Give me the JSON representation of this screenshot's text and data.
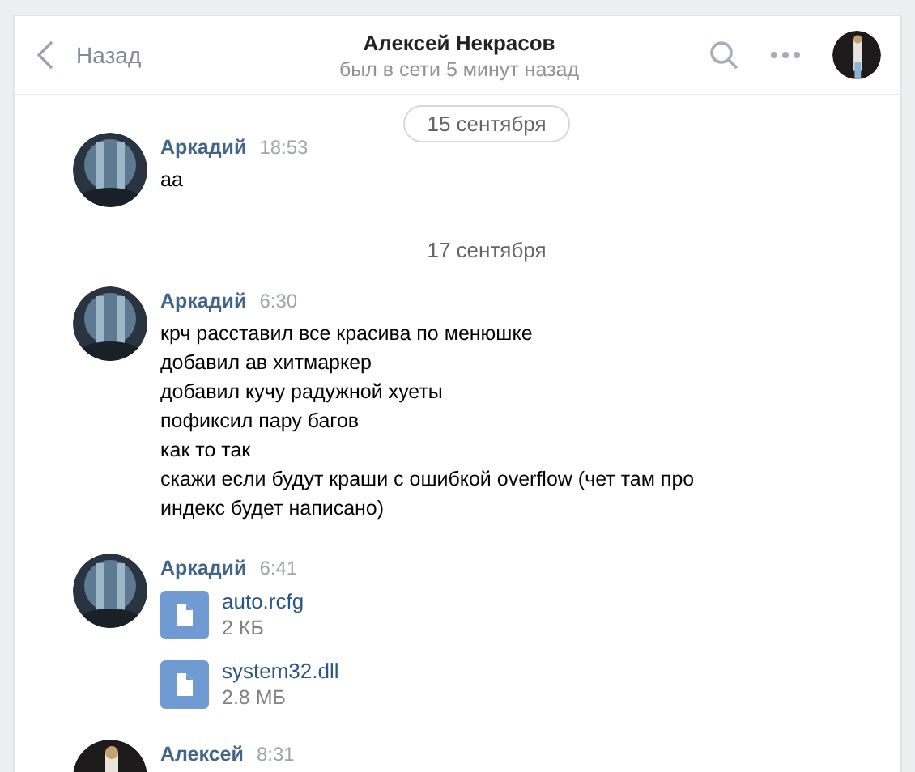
{
  "header": {
    "back": "Назад",
    "title": "Алексей Некрасов",
    "status": "был в сети 5 минут назад"
  },
  "feed": [
    {
      "kind": "date_pill",
      "text": "15 сентября"
    },
    {
      "kind": "message",
      "author": "Аркадий",
      "time": "18:53",
      "text": "аа"
    },
    {
      "kind": "date",
      "text": "17 сентября"
    },
    {
      "kind": "message",
      "author": "Аркадий",
      "time": "6:30",
      "text": "крч расставил все красива по менюшке\nдобавил ав хитмаркер\nдобавил кучу радужной хуеты\nпофиксил пару багов\nкак то так\nскажи если будут краши с ошибкой overflow (чет там про индекс будет написано)"
    },
    {
      "kind": "files",
      "author": "Аркадий",
      "time": "6:41",
      "files": [
        {
          "name": "auto.rcfg",
          "size": "2 КБ"
        },
        {
          "name": "system32.dll",
          "size": "2.8 МБ"
        }
      ]
    },
    {
      "kind": "message",
      "author": "Алексей",
      "time": "8:31"
    }
  ]
}
